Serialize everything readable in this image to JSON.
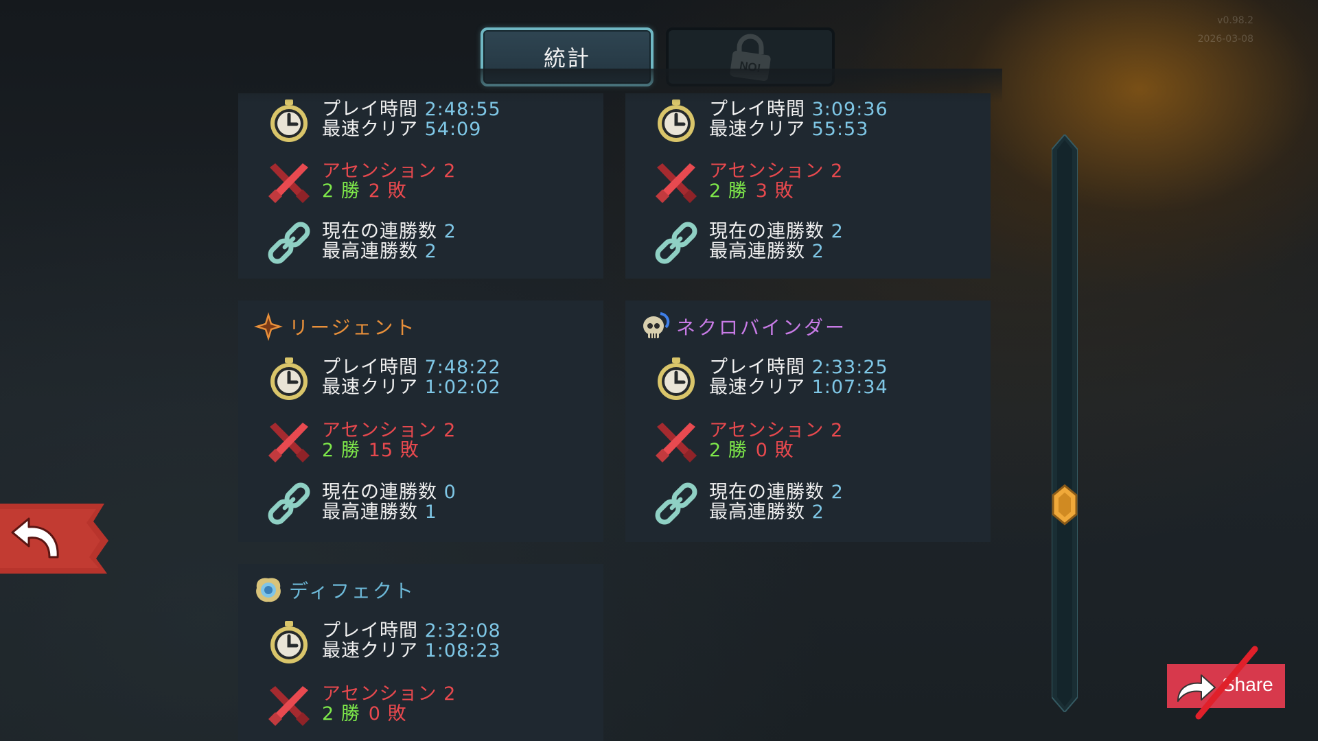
{
  "version": {
    "number": "v0.98.2",
    "date": "2026-03-08"
  },
  "tabs": {
    "stats_label": "統計",
    "locked_badge": "NO!"
  },
  "labels": {
    "playtime": "プレイ時間",
    "fastest": "最速クリア",
    "ascension": "アセンション",
    "wins_suffix": "勝",
    "losses_suffix": "敗",
    "current_streak": "現在の連勝数",
    "best_streak": "最高連勝数"
  },
  "characters": [
    {
      "name": "",
      "playtime": "2:48:55",
      "fastest": "54:09",
      "ascension": "2",
      "wins": "2",
      "losses": "2",
      "current_streak": "2",
      "best_streak": "2"
    },
    {
      "name": "",
      "playtime": "3:09:36",
      "fastest": "55:53",
      "ascension": "2",
      "wins": "2",
      "losses": "3",
      "current_streak": "2",
      "best_streak": "2"
    },
    {
      "name": "リージェント",
      "name_color": "#e9903a",
      "icon": "regent-crown-icon",
      "playtime": "7:48:22",
      "fastest": "1:02:02",
      "ascension": "2",
      "wins": "2",
      "losses": "15",
      "current_streak": "0",
      "best_streak": "1"
    },
    {
      "name": "ネクロバインダー",
      "name_color": "#c87be6",
      "icon": "necrobinder-skull-icon",
      "playtime": "2:33:25",
      "fastest": "1:07:34",
      "ascension": "2",
      "wins": "2",
      "losses": "0",
      "current_streak": "2",
      "best_streak": "2"
    },
    {
      "name": "ディフェクト",
      "name_color": "#6db9d8",
      "icon": "defect-orb-icon",
      "playtime": "2:32:08",
      "fastest": "1:08:23",
      "ascension": "2",
      "wins": "2",
      "losses": "0"
    }
  ],
  "scroll": {
    "position": 0.66
  },
  "share": {
    "label": "Share"
  },
  "colors": {
    "accent_teal": "#6fb7c3",
    "share_red": "#d7394c",
    "back_red": "#b8342c"
  }
}
